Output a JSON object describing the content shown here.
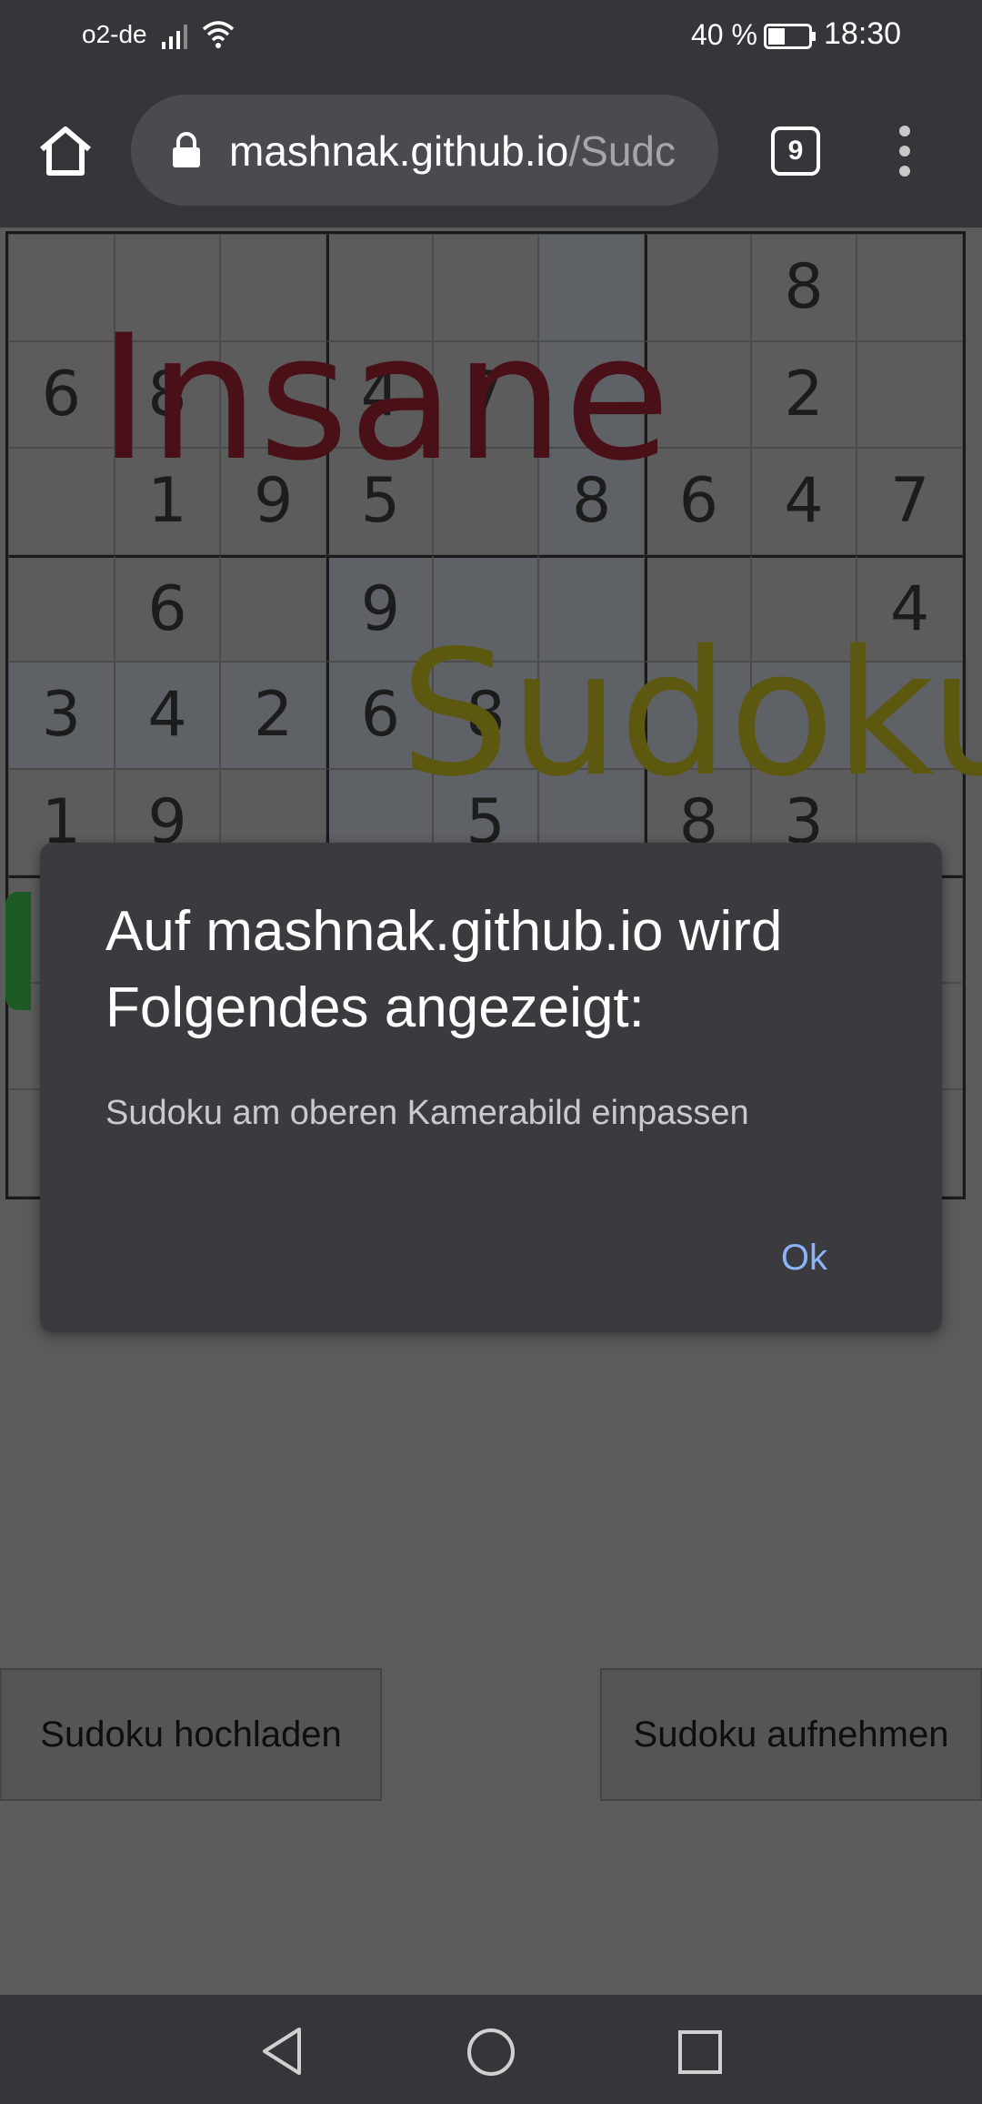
{
  "status_bar": {
    "carrier": "o2-de",
    "battery_percent": "40 %",
    "battery_level": 0.4,
    "time": "18:30",
    "icons": [
      "signal-icon",
      "wifi-icon",
      "battery-icon"
    ]
  },
  "browser": {
    "url_host": "mashnak.github.io",
    "url_path": "/Sudc",
    "tab_count": "9",
    "icons": [
      "home-icon",
      "lock-icon",
      "tabs-icon",
      "more-vert-icon"
    ]
  },
  "page": {
    "overlay_insane": "Insane",
    "overlay_sudoku": "Sudoku",
    "sudoku_rows": [
      [
        "",
        "",
        "",
        "",
        "",
        "",
        "",
        "8",
        ""
      ],
      [
        "6",
        "8",
        "",
        "4",
        "7",
        "",
        "",
        "2",
        ""
      ],
      [
        "",
        "1",
        "9",
        "5",
        "",
        "8",
        "6",
        "4",
        "7"
      ],
      [
        "",
        "6",
        "",
        "9",
        "",
        "",
        "",
        "",
        "4"
      ],
      [
        "3",
        "4",
        "2",
        "6",
        "8",
        "",
        "",
        "",
        ""
      ],
      [
        "1",
        "9",
        "",
        "",
        "5",
        "",
        "8",
        "3",
        ""
      ],
      [
        "",
        "",
        "",
        "",
        "",
        "",
        "",
        "",
        ""
      ],
      [
        "",
        "",
        "",
        "",
        "",
        "",
        "",
        "",
        ""
      ],
      [
        "",
        "",
        "",
        "",
        "",
        "",
        "",
        "",
        ""
      ]
    ],
    "upload_button": "Sudoku hochladen",
    "capture_button": "Sudoku aufnehmen"
  },
  "dialog": {
    "title": "Auf mashnak.github.io wird Folgendes angezeigt:",
    "message": "Sudoku am oberen Kamerabild einpassen",
    "ok_button": "Ok"
  },
  "nav_bar": {
    "icons": [
      "back-icon",
      "home-circle-icon",
      "recents-icon"
    ]
  },
  "colors": {
    "chrome_dark": "#35363a",
    "dim_page": "#5b5b5b",
    "dialog_bg": "#3a3a3f",
    "link_blue": "#8ab4f8"
  }
}
